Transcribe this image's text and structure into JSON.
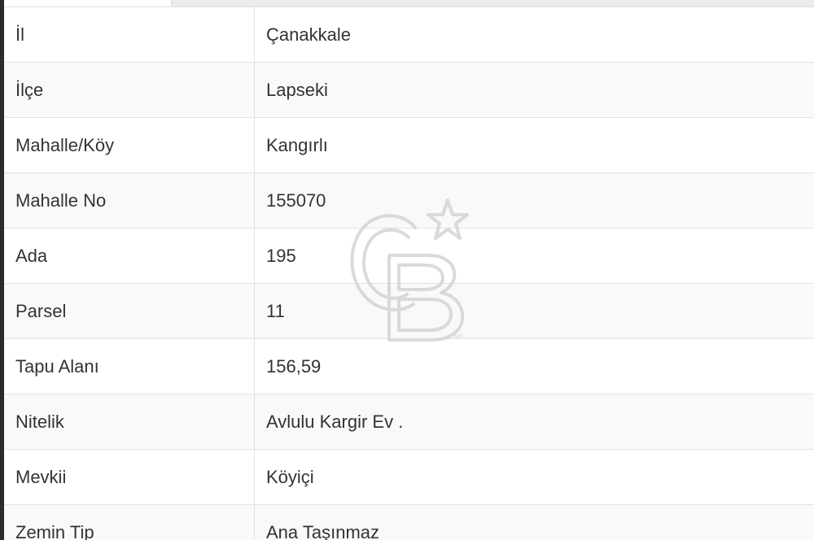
{
  "property_table": {
    "rows": [
      {
        "label": "İl",
        "value": "Çanakkale"
      },
      {
        "label": "İlçe",
        "value": "Lapseki"
      },
      {
        "label": "Mahalle/Köy",
        "value": "Kangırlı"
      },
      {
        "label": "Mahalle No",
        "value": "155070"
      },
      {
        "label": "Ada",
        "value": "195"
      },
      {
        "label": "Parsel",
        "value": "11"
      },
      {
        "label": "Tapu Alanı",
        "value": "156,59"
      },
      {
        "label": "Nitelik",
        "value": "Avlulu Kargir Ev ."
      },
      {
        "label": "Mevkii",
        "value": "Köyiçi"
      },
      {
        "label": "Zemin Tip",
        "value": "Ana Taşınmaz"
      }
    ]
  },
  "watermark": {
    "icon": "coldwell-banker-logo",
    "color": "#d9d9d9"
  },
  "colors": {
    "text": "#333333",
    "border": "#e2e2e2",
    "stripe": "#f9f9f9"
  }
}
